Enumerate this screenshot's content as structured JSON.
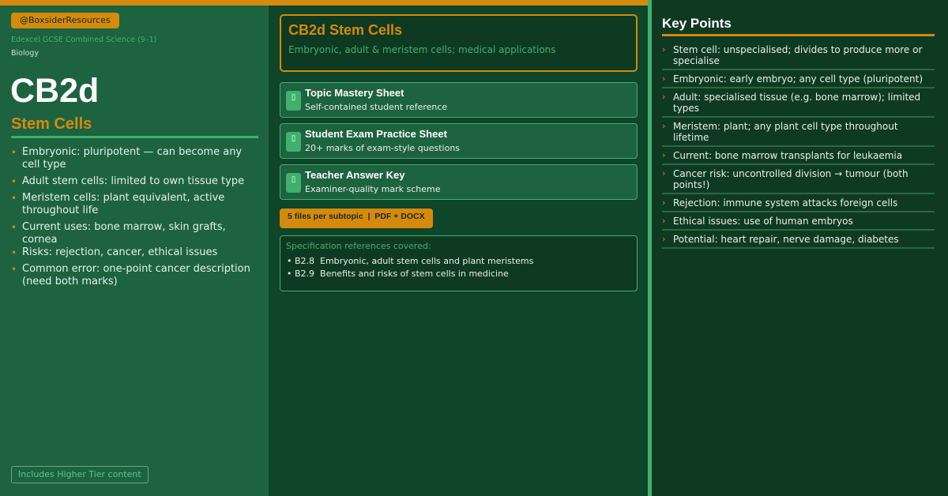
{
  "handle": "@BoxsiderResources",
  "exam_board": "Edexcel GCSE Combined Science (9–1)",
  "subject": "Biology",
  "code": "CB2d",
  "topic_title": "Stem Cells",
  "left_bullets": [
    "Embryonic: pluripotent — can become any cell type",
    "Adult stem cells: limited to own tissue type",
    "Meristem cells: plant equivalent, active throughout life",
    "Current uses: bone marrow, skin grafts, cornea",
    "Risks: rejection, cancer, ethical issues",
    "Common error: one-point cancer description (need both marks)"
  ],
  "tier_badge": "Includes Higher Tier content",
  "header": {
    "title": "CB2d Stem Cells",
    "subtitle": "Embryonic, adult & meristem cells; medical applications"
  },
  "resources": [
    {
      "title": "Topic Mastery Sheet",
      "desc": "Self-contained student reference",
      "icon": "document-icon"
    },
    {
      "title": "Student Exam Practice Sheet",
      "desc": "20+ marks of exam-style questions",
      "icon": "document-icon"
    },
    {
      "title": "Teacher Answer Key",
      "desc": "Examiner-quality mark scheme",
      "icon": "document-icon"
    }
  ],
  "files_badge": "5 files per subtopic  |  PDF + DOCX",
  "spec": {
    "heading": "Specification references covered:",
    "items": [
      "• B2.8  Embryonic, adult stem cells and plant meristems",
      "• B2.9  Benefits and risks of stem cells in medicine"
    ]
  },
  "key_points": {
    "title": "Key Points",
    "items": [
      "Stem cell: unspecialised; divides to produce more or specialise",
      "Embryonic: early embryo; any cell type (pluripotent)",
      "Adult: specialised tissue (e.g. bone marrow); limited types",
      "Meristem: plant; any plant cell type throughout lifetime",
      "Current: bone marrow transplants for leukaemia",
      "Cancer risk: uncontrolled division → tumour (both points!)",
      "Rejection: immune system attacks foreign cells",
      "Ethical issues: use of human embryos",
      "Potential: heart repair, nerve damage, diabetes"
    ]
  },
  "colors": {
    "accent_orange": "#d48a0c",
    "accent_green": "#3fb06d",
    "panel_green": "#1d6340",
    "dark_green": "#0f3a22"
  }
}
